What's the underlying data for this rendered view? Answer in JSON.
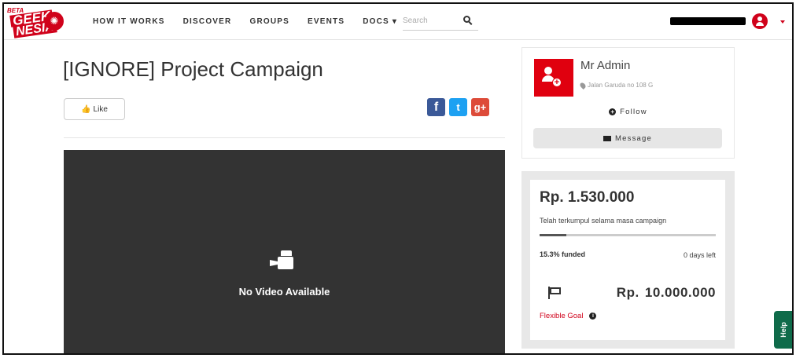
{
  "brand": {
    "beta": "BETA",
    "line1": "GEEK",
    "line2": "NESIA",
    "accent": "#d0021b"
  },
  "nav": {
    "items": [
      {
        "label": "HOW IT WORKS"
      },
      {
        "label": "DISCOVER"
      },
      {
        "label": "GROUPS"
      },
      {
        "label": "EVENTS"
      },
      {
        "label": "DOCS ▾"
      }
    ],
    "search_placeholder": "Search"
  },
  "campaign": {
    "title": "[IGNORE] Project Campaign",
    "like_label": "Like",
    "social": {
      "facebook": "f",
      "twitter": "t",
      "googleplus": "g+"
    },
    "video_message": "No Video Available"
  },
  "owner": {
    "name": "Mr Admin",
    "location": "Jalan Garuda no 108 G",
    "follow_label": "Follow",
    "message_label": "Message"
  },
  "funding": {
    "raised": "Rp. 1.530.000",
    "raised_caption": "Telah terkumpul selama masa campaign",
    "progress_fraction": 0.153,
    "funded_text": "15.3% funded",
    "days_left": "0 days left",
    "goal": "Rp.  10.000.000",
    "goal_type": "Flexible Goal"
  },
  "help": {
    "label": "Help",
    "color": "#0f6b4a"
  }
}
